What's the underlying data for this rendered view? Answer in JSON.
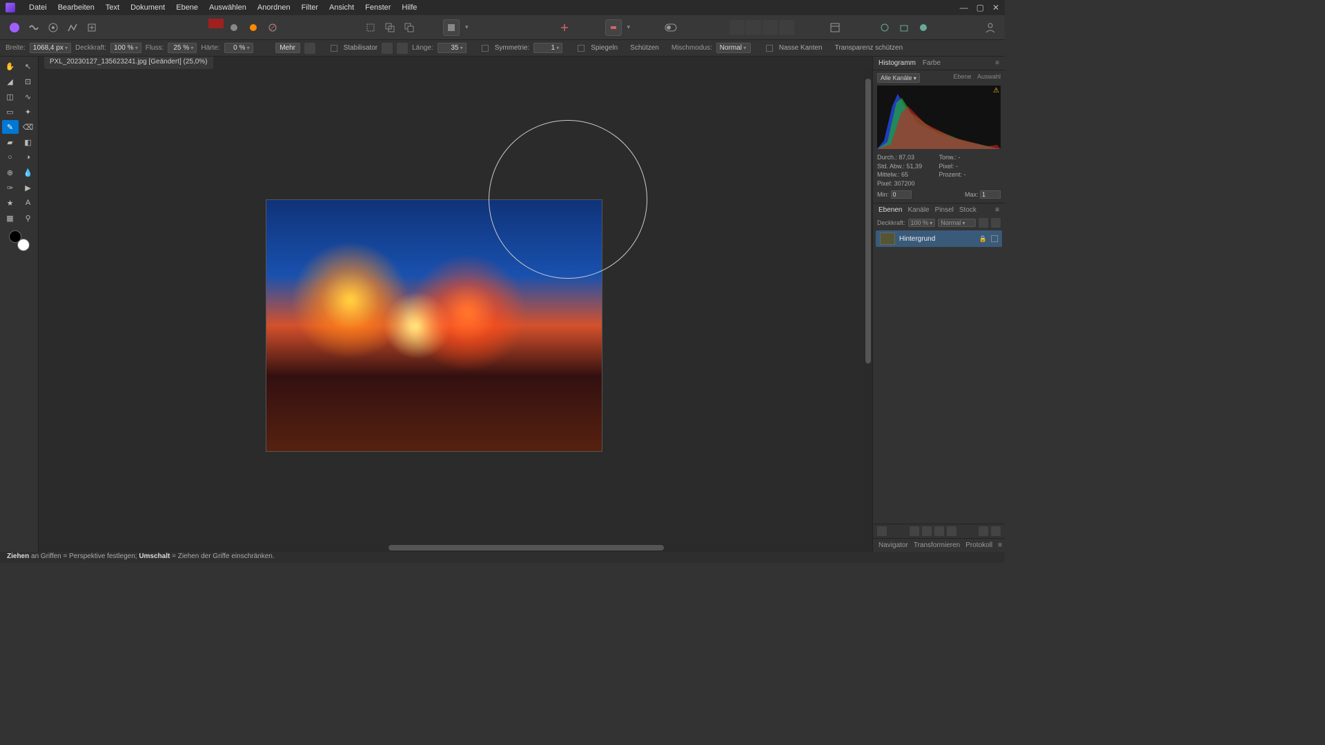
{
  "menubar": [
    "Datei",
    "Bearbeiten",
    "Text",
    "Dokument",
    "Ebene",
    "Auswählen",
    "Anordnen",
    "Filter",
    "Ansicht",
    "Fenster",
    "Hilfe"
  ],
  "optionsbar": {
    "breite_lbl": "Breite:",
    "breite_val": "1068,4 px",
    "deckkraft_lbl": "Deckkraft:",
    "deckkraft_val": "100 %",
    "fluss_lbl": "Fluss:",
    "fluss_val": "25 %",
    "haerte_lbl": "Härte:",
    "haerte_val": "0 %",
    "mehr": "Mehr",
    "stabilisator": "Stabilisator",
    "laenge_lbl": "Länge:",
    "laenge_val": "35",
    "symmetrie_lbl": "Symmetrie:",
    "symmetrie_val": "1",
    "spiegeln": "Spiegeln",
    "schuetzen": "Schützen",
    "mischmodus_lbl": "Mischmodus:",
    "mischmodus_val": "Normal",
    "nasse": "Nasse Kanten",
    "transparenz": "Transparenz schützen"
  },
  "doc_tab": {
    "title": "PXL_20230127_135623241.jpg [Geändert] (25,0%)",
    "close": "×"
  },
  "histogram": {
    "tabs": [
      "Histogramm",
      "Farbe"
    ],
    "channel": "Alle Kanäle",
    "links": [
      "Ebene",
      "Auswahl"
    ],
    "stats": {
      "durch_lbl": "Durch.:",
      "durch_val": "87,03",
      "std_lbl": "Std. Abw.:",
      "std_val": "51,39",
      "mittel_lbl": "Mittelw.:",
      "mittel_val": "65",
      "pixel_lbl": "Pixel:",
      "pixel_val": "307200",
      "tonw_lbl": "Tonw.:",
      "tonw_val": "-",
      "pixel2_lbl": "Pixel:",
      "pixel2_val": "-",
      "prozent_lbl": "Prozent:",
      "prozent_val": "-"
    },
    "min_lbl": "Min:",
    "min_val": "0",
    "max_lbl": "Max:",
    "max_val": "1"
  },
  "layers": {
    "tabs": [
      "Ebenen",
      "Kanäle",
      "Pinsel",
      "Stock"
    ],
    "opacity_lbl": "Deckkraft:",
    "opacity_val": "100 %",
    "blend_val": "Normal",
    "layer_name": "Hintergrund",
    "bottom_tabs": [
      "Navigator",
      "Transformieren",
      "Protokoll"
    ]
  },
  "statusbar": {
    "s1": "Ziehen",
    "t1": " an Griffen = Perspektive festlegen; ",
    "s2": "Umschalt",
    "t2": " = Ziehen der Griffe einschränken."
  }
}
